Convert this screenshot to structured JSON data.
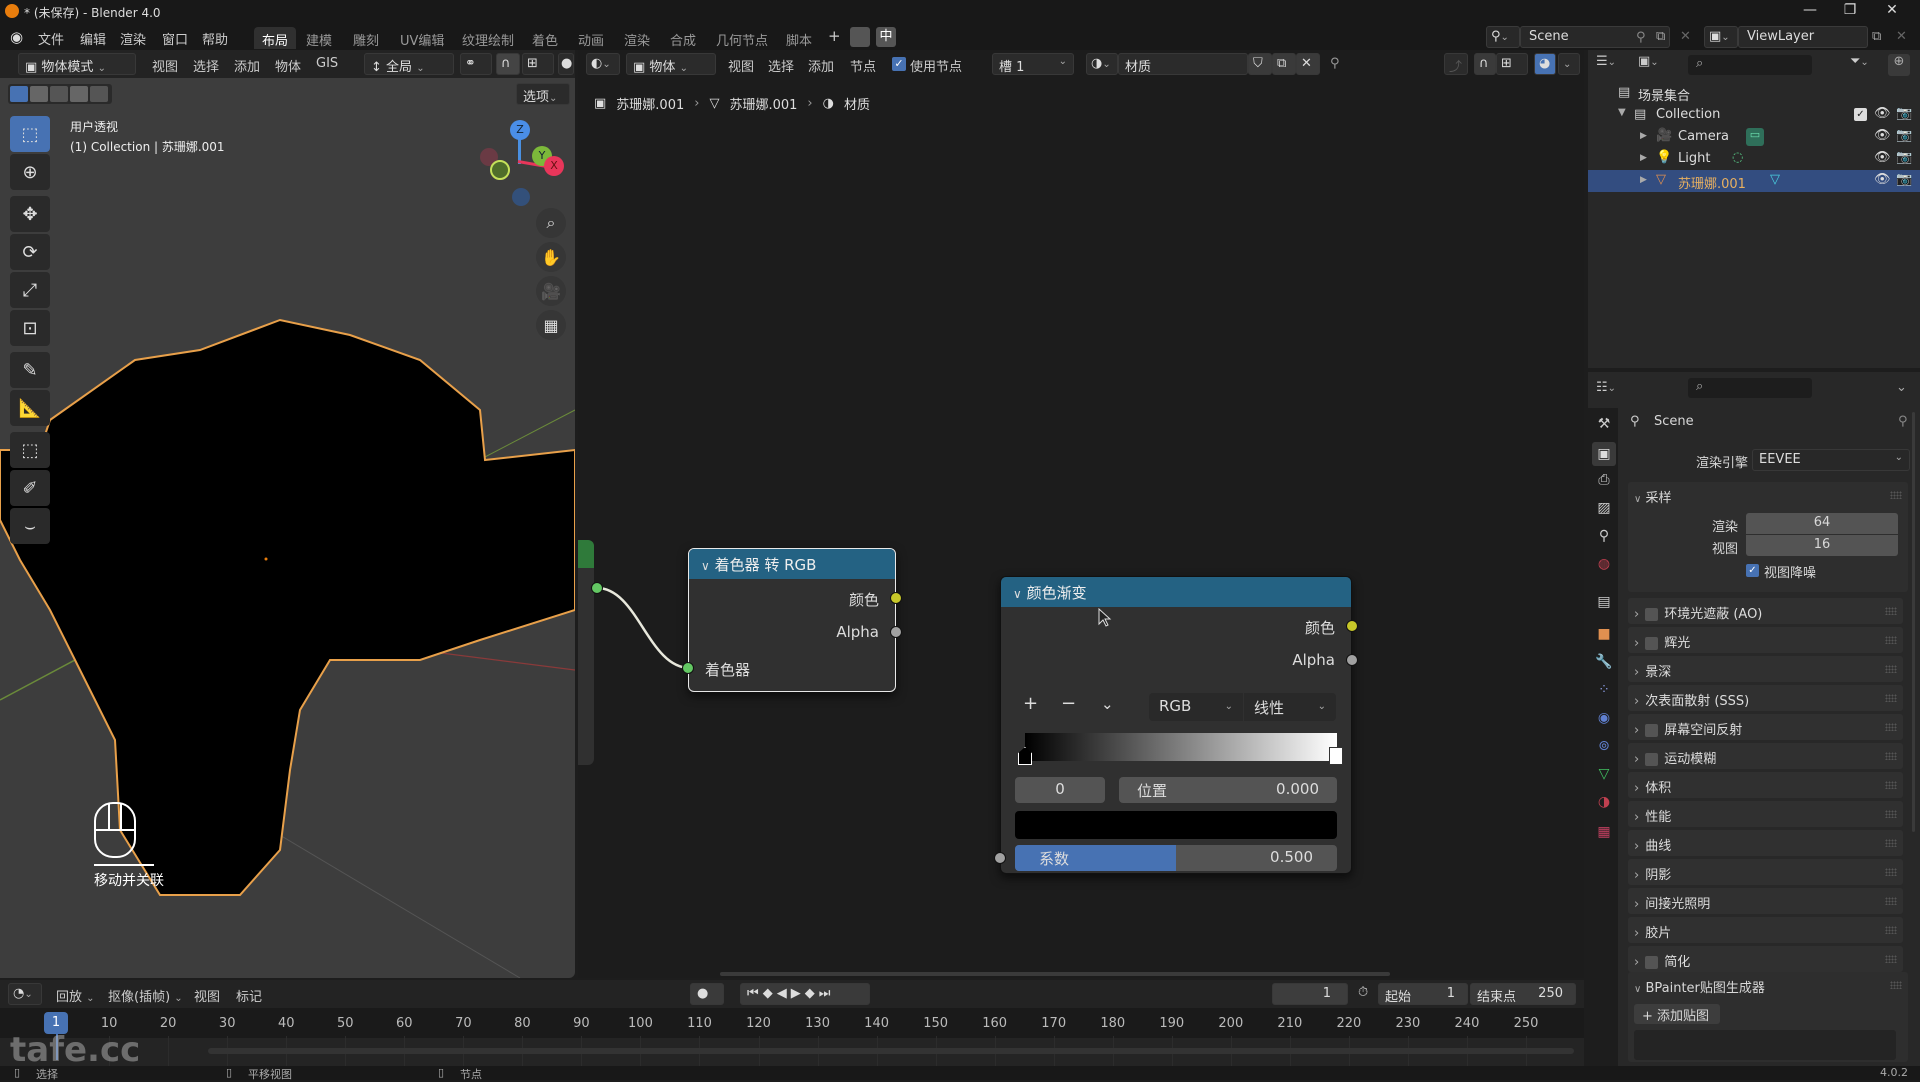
{
  "window": {
    "title": "* (未保存) - Blender 4.0",
    "controls": [
      "minimize",
      "maximize",
      "close"
    ]
  },
  "menubar": {
    "menus": [
      "文件",
      "编辑",
      "渲染",
      "窗口",
      "帮助"
    ],
    "workspaces": [
      "布局",
      "建模",
      "雕刻",
      "UV编辑",
      "纹理绘制",
      "着色",
      "动画",
      "渲染",
      "合成",
      "几何节点",
      "脚本"
    ],
    "active_workspace": "布局",
    "add_workspace": "+",
    "lang_badge": "中",
    "scene": "Scene",
    "view_layer": "ViewLayer"
  },
  "viewport": {
    "mode": "物体模式",
    "menus": [
      "视图",
      "选择",
      "添加",
      "物体",
      "GIS"
    ],
    "transform_orientation": "全局",
    "options_label": "选项",
    "view_name": "用户透视",
    "collection_info": "(1) Collection | 苏珊娜.001",
    "mouse_hint": "移动并关联",
    "gizmo_axes": [
      "Z",
      "Y",
      "X"
    ]
  },
  "node_editor": {
    "object_type": "物体",
    "menus": [
      "视图",
      "选择",
      "添加",
      "节点"
    ],
    "use_nodes_label": "使用节点",
    "use_nodes": true,
    "slot": "槽 1",
    "material": "材质",
    "breadcrumb": [
      "苏珊娜.001",
      "苏珊娜.001",
      "材质"
    ],
    "nodes": {
      "shader_to_rgb": {
        "title": "着色器 转 RGB",
        "outputs": [
          "颜色",
          "Alpha"
        ],
        "inputs": [
          "着色器"
        ]
      },
      "color_ramp": {
        "title": "颜色渐变",
        "outputs": [
          "颜色",
          "Alpha"
        ],
        "add": "+",
        "remove": "−",
        "color_mode": "RGB",
        "interpolation": "线性",
        "active_stop_index": "0",
        "position_label": "位置",
        "position_value": "0.000",
        "stop_color": "#000000",
        "factor_label": "系数",
        "factor_value": "0.500",
        "factor_fraction": 0.5
      }
    }
  },
  "outliner": {
    "root": "场景集合",
    "items": [
      {
        "name": "Collection",
        "type": "collection"
      },
      {
        "name": "Camera",
        "type": "camera"
      },
      {
        "name": "Light",
        "type": "light"
      },
      {
        "name": "苏珊娜.001",
        "type": "mesh",
        "selected": true
      }
    ]
  },
  "properties": {
    "context": "Scene",
    "render_engine_label": "渲染引擎",
    "render_engine": "EEVEE",
    "sampling": {
      "title": "采样",
      "render_label": "渲染",
      "render_value": "64",
      "viewport_label": "视图",
      "viewport_value": "16",
      "denoise_label": "视图降噪",
      "denoise": true
    },
    "panels": [
      {
        "label": "环境光遮蔽 (AO)",
        "checkbox": true
      },
      {
        "label": "辉光",
        "checkbox": true
      },
      {
        "label": "景深",
        "checkbox": false
      },
      {
        "label": "次表面散射 (SSS)",
        "checkbox": false
      },
      {
        "label": "屏幕空间反射",
        "checkbox": true
      },
      {
        "label": "运动模糊",
        "checkbox": true
      },
      {
        "label": "体积",
        "checkbox": false
      },
      {
        "label": "性能",
        "checkbox": false
      },
      {
        "label": "曲线",
        "checkbox": false
      },
      {
        "label": "阴影",
        "checkbox": false
      },
      {
        "label": "间接光照明",
        "checkbox": false
      },
      {
        "label": "胶片",
        "checkbox": false
      },
      {
        "label": "简化",
        "checkbox": true
      }
    ],
    "bpainter": {
      "title": "BPainter贴图生成器",
      "add_label": "添加贴图"
    }
  },
  "timeline": {
    "menus": [
      "回放",
      "抠像(插帧)",
      "视图",
      "标记"
    ],
    "current_frame": "1",
    "start_label": "起始",
    "start": "1",
    "end_label": "结束点",
    "end": "250",
    "ticks": [
      "10",
      "20",
      "30",
      "40",
      "50",
      "60",
      "70",
      "80",
      "90",
      "100",
      "110",
      "120",
      "130",
      "140",
      "150",
      "160",
      "170",
      "180",
      "190",
      "200",
      "210",
      "220",
      "230",
      "240",
      "250"
    ]
  },
  "statusbar": {
    "items": [
      "选择",
      "平移视图",
      "节点"
    ],
    "version": "4.0.2",
    "watermark": "tafe.cc"
  }
}
